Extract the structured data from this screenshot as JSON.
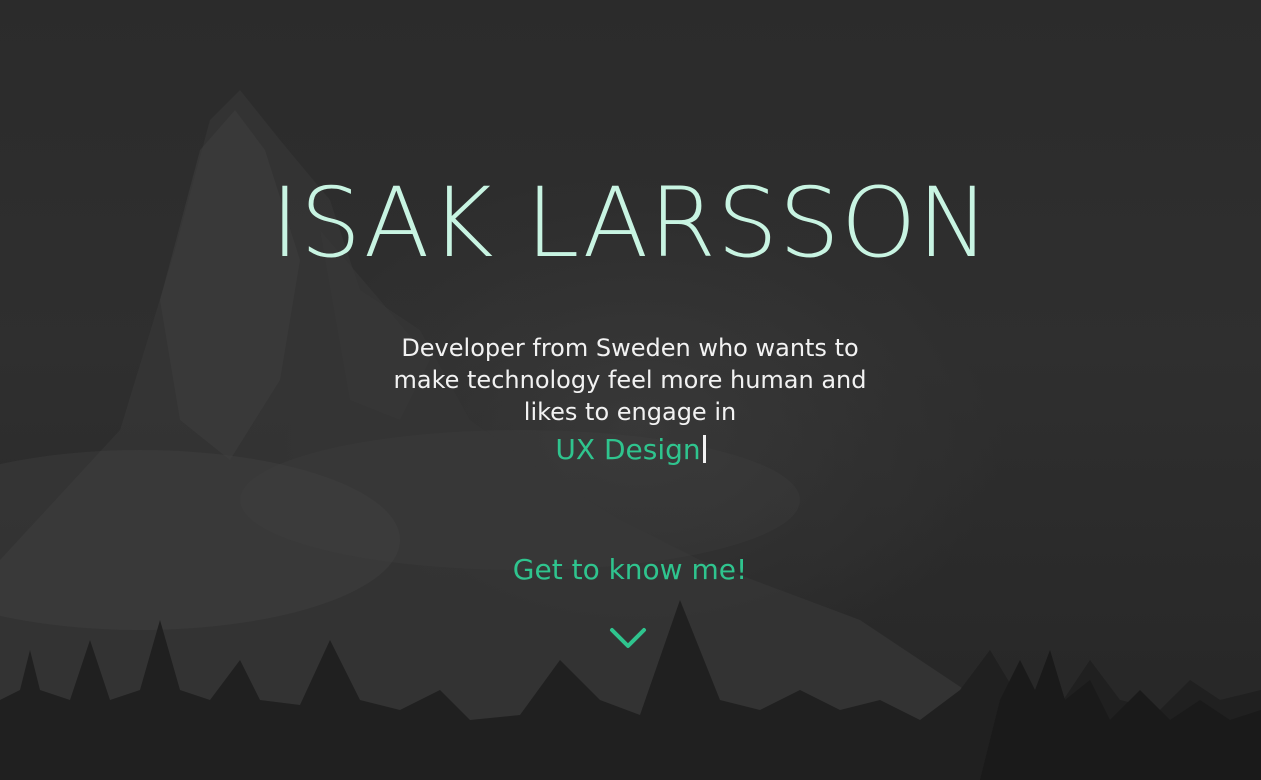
{
  "hero": {
    "name": "ISAK LARSSON",
    "tagline": "Developer from Sweden who wants to make technology feel more human and likes to engage in",
    "typed_word": "UX Design",
    "cta_label": "Get to know me!",
    "scroll_icon": "chevron-down-icon"
  },
  "colors": {
    "accent": "#2fc48e",
    "title": "#c8f4e2",
    "text": "#f2f2f2",
    "background": "#2e2e2e"
  }
}
